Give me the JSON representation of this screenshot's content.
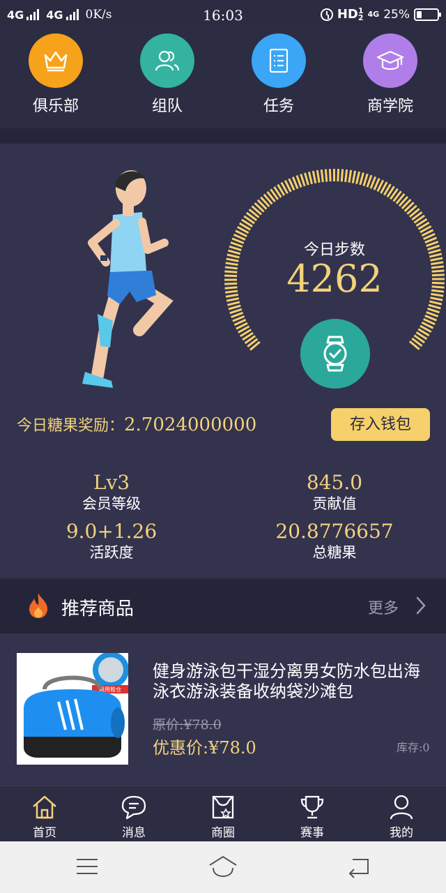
{
  "status_bar": {
    "net1": "4G",
    "net2": "4G",
    "speed": "0K/s",
    "time": "16:03",
    "hd": "HD",
    "hd_sup": "1",
    "hd_sub": "2",
    "net3": "4G",
    "battery": "25%",
    "battery_level": 0.25
  },
  "quick_nav": [
    {
      "label": "俱乐部",
      "icon": "crown-icon",
      "color": "#f7a21b"
    },
    {
      "label": "组队",
      "icon": "team-icon",
      "color": "#34b3a0"
    },
    {
      "label": "任务",
      "icon": "task-list-icon",
      "color": "#3aa6f5"
    },
    {
      "label": "商学院",
      "icon": "graduation-cap-icon",
      "color": "#b07ee8"
    }
  ],
  "steps": {
    "label": "今日步数",
    "value": "4262",
    "gauge_color": "#f5d06b",
    "watch_color": "#2ba89a"
  },
  "candy": {
    "label": "今日糖果奖励：",
    "value": "2.7024000000",
    "button": "存入钱包"
  },
  "stats": [
    {
      "value": "Lv3",
      "label": "会员等级"
    },
    {
      "value": "845.0",
      "label": "贡献值"
    },
    {
      "value": "9.0+1.26",
      "label": "活跃度"
    },
    {
      "value": "20.8776657",
      "label": "总糖果"
    }
  ],
  "recommend": {
    "title": "推荐商品",
    "more": "更多"
  },
  "product": {
    "title": "健身游泳包干湿分离男女防水包出海泳衣游泳装备收纳袋沙滩包",
    "original_price": "原价:¥78.0",
    "price": "优惠价:¥78.0",
    "stock": "库存:0",
    "badge": "两用鞋仓"
  },
  "tabs": [
    {
      "label": "首页",
      "icon": "home-icon",
      "active": true
    },
    {
      "label": "消息",
      "icon": "message-icon",
      "active": false
    },
    {
      "label": "商圈",
      "icon": "shop-icon",
      "active": false
    },
    {
      "label": "赛事",
      "icon": "trophy-icon",
      "active": false
    },
    {
      "label": "我的",
      "icon": "profile-icon",
      "active": false
    }
  ],
  "colors": {
    "accent": "#f3d27a",
    "background": "#2c2c43",
    "panel": "#33334e"
  }
}
